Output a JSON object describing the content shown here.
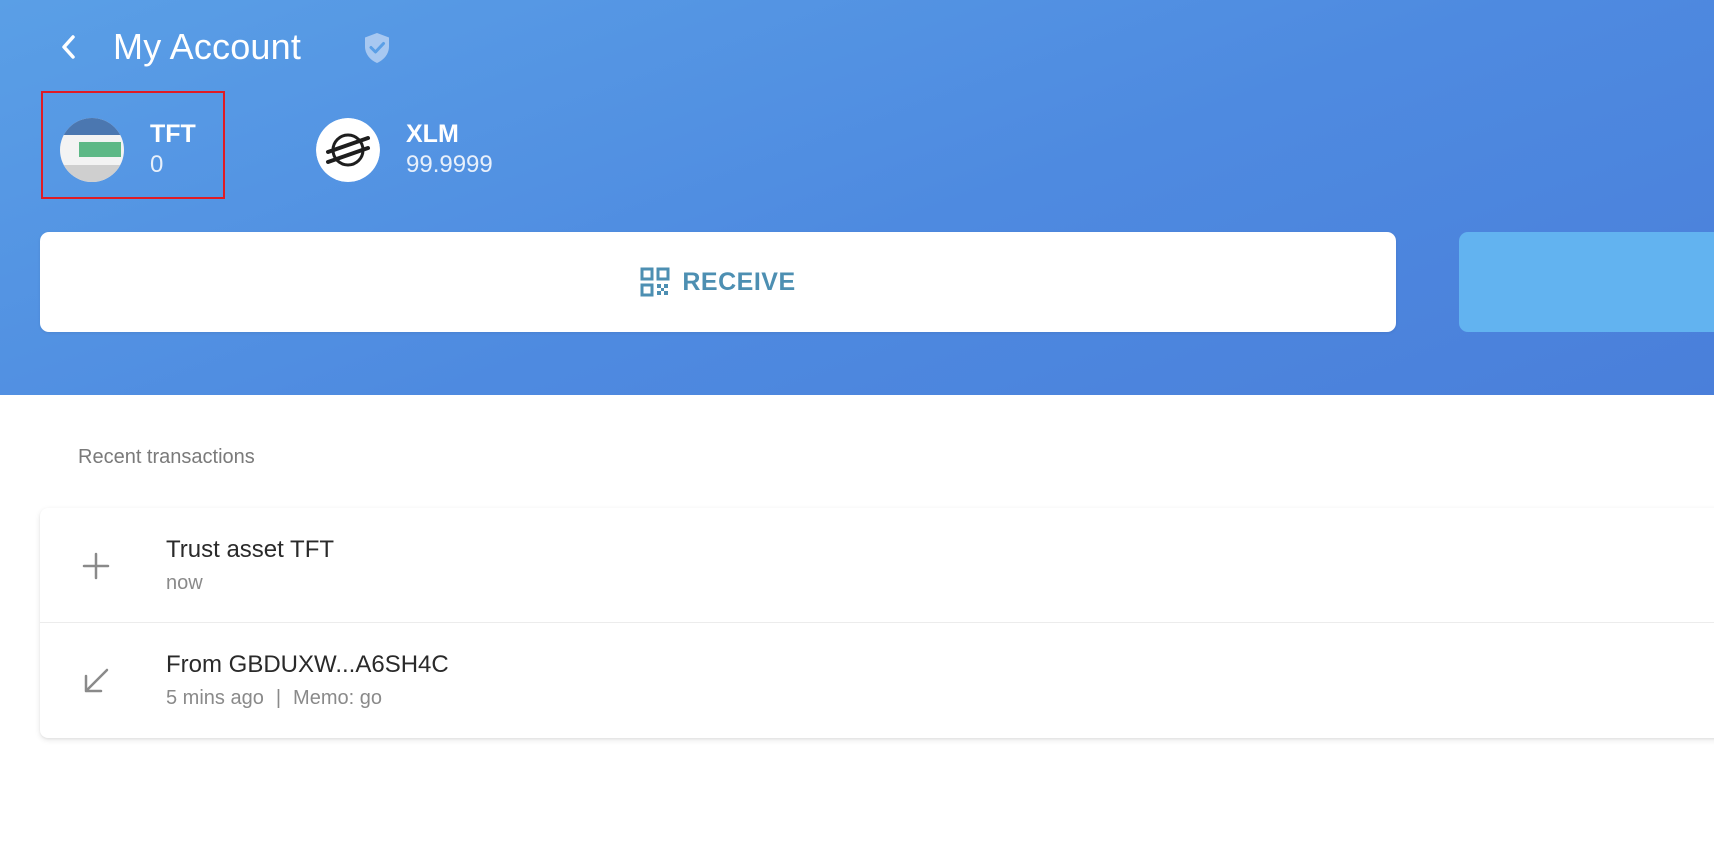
{
  "header": {
    "title": "My Account",
    "back_icon": "chevron-left-icon",
    "verified_icon": "shield-check-icon"
  },
  "assets": [
    {
      "code": "TFT",
      "balance": "0",
      "icon": "tft-logo-icon",
      "selected": true
    },
    {
      "code": "XLM",
      "balance": "99.9999",
      "icon": "stellar-logo-icon",
      "selected": false
    }
  ],
  "actions": {
    "receive_label": "RECEIVE",
    "receive_icon": "qr-code-icon"
  },
  "transactions": {
    "section_label": "Recent transactions",
    "items": [
      {
        "title": "Trust asset TFT",
        "time": "now",
        "memo": "",
        "icon": "plus-icon"
      },
      {
        "title": "From GBDUXW...A6SH4C",
        "time": "5 mins ago",
        "memo": "Memo: go",
        "icon": "arrow-down-left-icon"
      }
    ]
  },
  "colors": {
    "header_gradient_start": "#5a9fe6",
    "header_gradient_end": "#4a7fda",
    "receive_text": "#4d8fb2",
    "send_button": "#62b3f0",
    "selection_outline": "#e01b24"
  }
}
